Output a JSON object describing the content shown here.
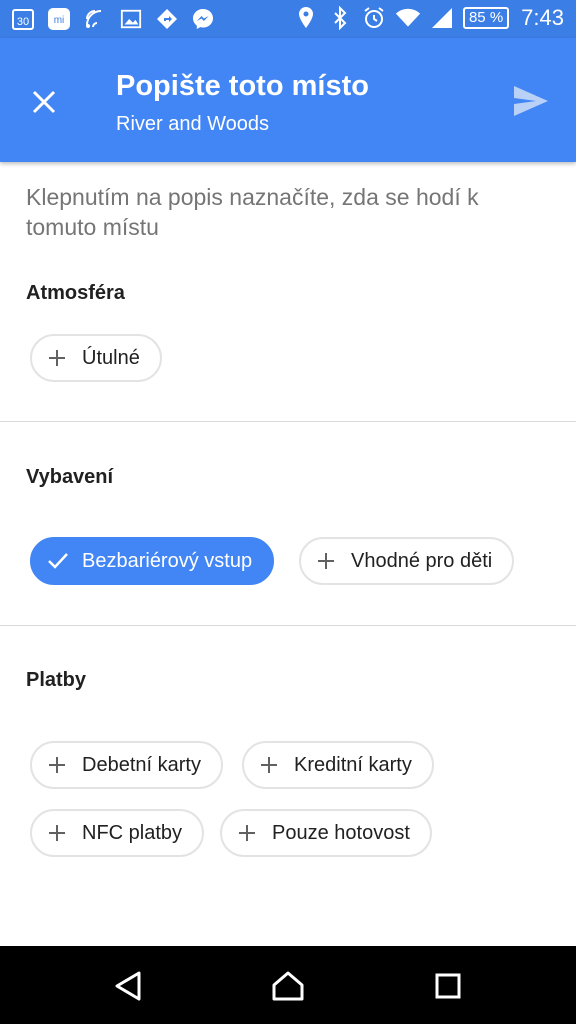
{
  "status_bar": {
    "notification_icons": [
      "calendar-icon",
      "mi-icon",
      "wifi-calling-icon",
      "gallery-icon",
      "navigation-icon",
      "messenger-icon"
    ],
    "calendar_day": "30",
    "system_icons": [
      "location-icon",
      "bluetooth-icon",
      "alarm-icon",
      "wifi-icon",
      "signal-icon"
    ],
    "battery": "85 %",
    "time": "7:43"
  },
  "app_bar": {
    "title": "Popište toto místo",
    "subtitle": "River and Woods",
    "close_icon": "close-icon",
    "send_icon": "send-icon"
  },
  "intro_text": "Klepnutím na popis naznačíte, zda se hodí k tomuto místu",
  "sections": [
    {
      "title": "Atmosféra",
      "chips": [
        {
          "label": "Útulné",
          "selected": false
        }
      ]
    },
    {
      "title": "Vybavení",
      "chips": [
        {
          "label": "Bezbariérový vstup",
          "selected": true
        },
        {
          "label": "Vhodné pro děti",
          "selected": false
        }
      ]
    },
    {
      "title": "Platby",
      "chips": [
        {
          "label": "Debetní karty",
          "selected": false
        },
        {
          "label": "Kreditní karty",
          "selected": false
        },
        {
          "label": "NFC platby",
          "selected": false
        },
        {
          "label": "Pouze hotovost",
          "selected": false
        }
      ]
    }
  ],
  "colors": {
    "accent": "#4285f4",
    "status_bar": "#3b7ee6",
    "chip_border": "#e3e3e3",
    "intro_text": "#757575"
  },
  "nav_bar": {
    "icons": [
      "back-icon",
      "home-icon",
      "recents-icon"
    ]
  }
}
